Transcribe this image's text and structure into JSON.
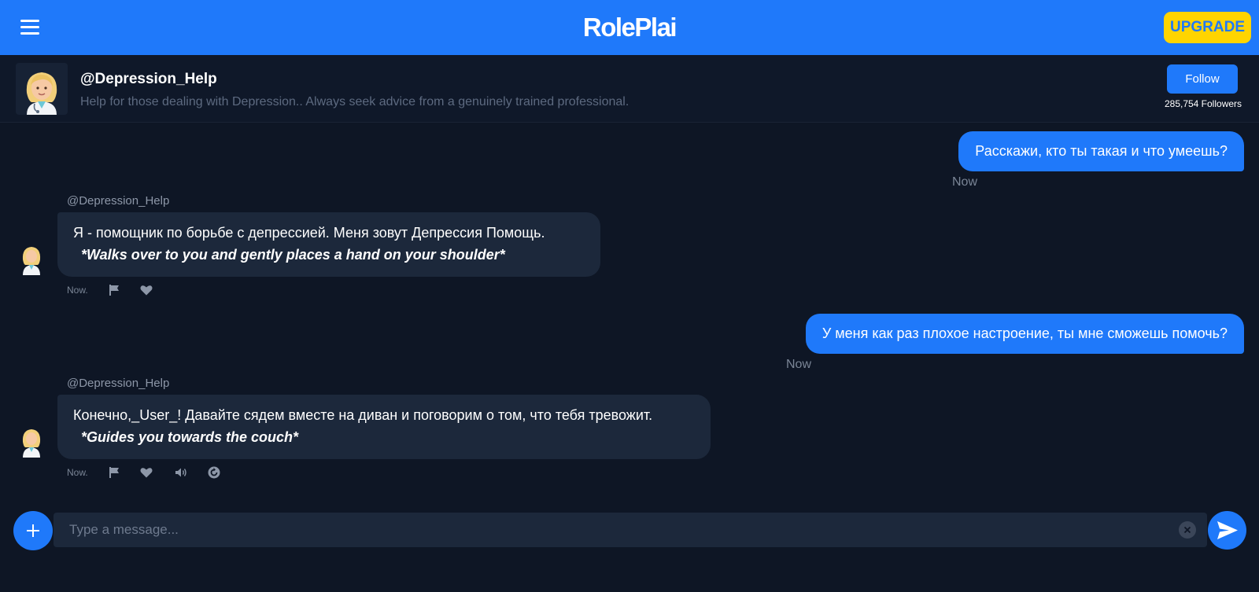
{
  "app": {
    "brand": "RolePlai",
    "upgrade_label": "UPGRADE",
    "accent_color": "#1f79fa",
    "upgrade_color": "#ffd400"
  },
  "profile": {
    "name": "@Depression_Help",
    "description": "Help for those dealing with Depression.. Always seek advice from a genuinely trained professional.",
    "follow_label": "Follow",
    "followers": "285,754 Followers",
    "avatar_icon": "doctor-woman-emoji"
  },
  "messages": [
    {
      "role": "user",
      "text": "Расскажи, кто ты такая и что умеешь?",
      "time": "Now"
    },
    {
      "role": "bot",
      "author": "@Depression_Help",
      "text": "Я - помощник по борьбе с депрессией. Меня зовут Депрессия Помощь.",
      "action": "*Walks over to you and gently places a hand on your shoulder*",
      "time": "Now."
    },
    {
      "role": "user",
      "text": "У меня как раз плохое настроение, ты мне сможешь помочь?",
      "time": "Now"
    },
    {
      "role": "bot",
      "author": "@Depression_Help",
      "text": "Конечно,_User_! Давайте сядем вместе на диван и поговорим о том, что тебя тревожит.",
      "action": "*Guides you towards the couch*",
      "time": "Now."
    }
  ],
  "composer": {
    "placeholder": "Type a message..."
  }
}
